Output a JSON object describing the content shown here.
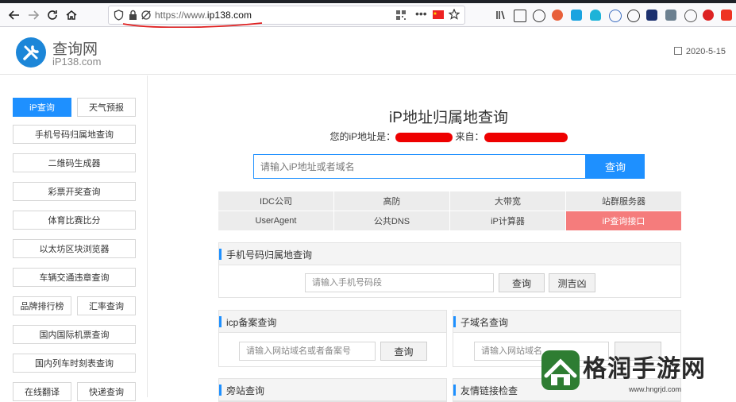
{
  "browser": {
    "url_scheme": "https://www.",
    "url_host": "ip138.com",
    "icons": [
      "back-icon",
      "forward-icon",
      "reload-icon",
      "home-icon",
      "shield-icon",
      "lock-icon",
      "tracking-icon",
      "qr-icon",
      "more-icon",
      "china-flag-icon",
      "star-icon",
      "library-icon",
      "sidebar-icon",
      "account-icon"
    ]
  },
  "header": {
    "logo_title": "查询网",
    "logo_sub": "iP138.com",
    "date": "2020-5-15"
  },
  "sidebar": {
    "items": [
      {
        "label": "iP查询",
        "active": true
      },
      {
        "label": "天气预报"
      },
      {
        "label": "手机号码归属地查询"
      },
      {
        "label": "二维码生成器"
      },
      {
        "label": "彩票开奖查询"
      },
      {
        "label": "体育比赛比分"
      },
      {
        "label": "以太坊区块浏览器"
      },
      {
        "label": "车辆交通违章查询"
      },
      {
        "label": "品牌排行榜"
      },
      {
        "label": "汇率查询"
      },
      {
        "label": "国内国际机票查询"
      },
      {
        "label": "国内列车时刻表查询"
      },
      {
        "label": "在线翻译"
      },
      {
        "label": "快递查询"
      }
    ]
  },
  "main": {
    "title": "iP地址归属地查询",
    "ip_label": "您的iP地址是：",
    "from_label": "来自：",
    "search_placeholder": "请输入iP地址或者域名",
    "search_button": "查询",
    "grid": [
      "IDC公司",
      "高防",
      "大带宽",
      "站群服务器",
      "UserAgent",
      "公共DNS",
      "iP计算器",
      "iP查询接口"
    ],
    "phone_panel": {
      "title": "手机号码归属地查询",
      "placeholder": "请输入手机号码段",
      "query_button": "查询",
      "luck_button": "测吉凶"
    },
    "icp_panel": {
      "title": "icp备案查询",
      "placeholder": "请输入网站域名或者备案号",
      "query_button": "查询"
    },
    "subdomain_panel": {
      "title": "子域名查询",
      "placeholder": "请输入网站域名"
    },
    "side_panel": {
      "title": "旁站查询"
    },
    "friend_panel": {
      "title": "友情链接检查"
    }
  },
  "watermark": {
    "text": "格润手游网",
    "url": "www.hngrjd.com"
  }
}
